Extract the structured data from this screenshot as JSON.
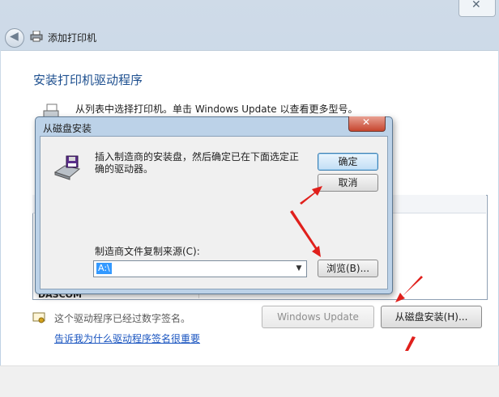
{
  "window": {
    "title": "添加打印机",
    "close_glyph": "✕",
    "back_glyph": "◀"
  },
  "wizard": {
    "heading": "安装打印机驱动程序",
    "instruction": "从列表中选择打印机。单击 Windows Update 以查看更多型号。",
    "list_partial_item": "DASCOM",
    "signature_text": "这个驱动程序已经过数字签名。",
    "signature_link": "告诉我为什么驱动程序签名很重要",
    "windows_update_button": "Windows Update",
    "have_disk_button": "从磁盘安装(H)..."
  },
  "dialog": {
    "title": "从磁盘安装",
    "close_glyph": "✕",
    "message": "插入制造商的安装盘，然后确定已在下面选定正确的驱动器。",
    "ok_button": "确定",
    "cancel_button": "取消",
    "source_label": "制造商文件复制来源(C):",
    "source_value": "A:\\",
    "combo_arrow": "▼",
    "browse_button": "浏览(B)..."
  },
  "colors": {
    "heading": "#1d4f8f",
    "link": "#1a55c0",
    "annotation_arrow": "#e0201c",
    "selection": "#3399ff"
  }
}
